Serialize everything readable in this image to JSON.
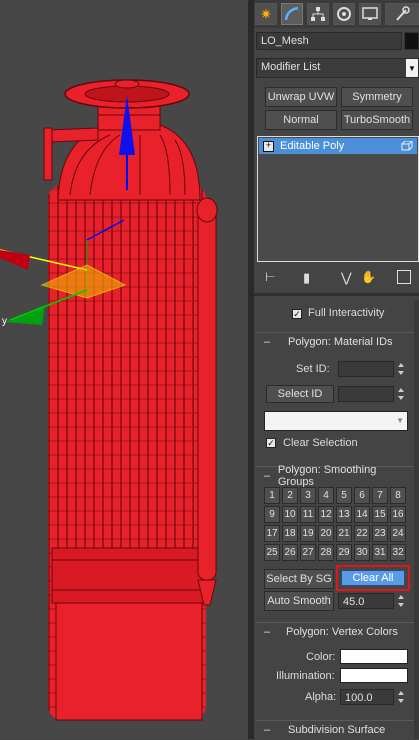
{
  "modifier_panel": {
    "object_name": "LO_Mesh",
    "modifier_list_label": "Modifier List",
    "buttons": {
      "unwrap": "Unwrap UVW",
      "symmetry": "Symmetry",
      "normal": "Normal",
      "turbosmooth": "TurboSmooth"
    },
    "stack": [
      {
        "label": "Editable Poly",
        "expand": "+"
      }
    ],
    "full_interactivity": "Full Interactivity"
  },
  "material_ids": {
    "title": "Polygon: Material IDs",
    "set_id_label": "Set ID:",
    "set_id_value": "",
    "select_id_button": "Select ID",
    "select_id_value": "",
    "dropdown_value": "",
    "clear_selection_label": "Clear Selection",
    "clear_selection_checked": true
  },
  "smoothing_groups": {
    "title": "Polygon: Smoothing Groups",
    "groups": [
      "1",
      "2",
      "3",
      "4",
      "5",
      "6",
      "7",
      "8",
      "9",
      "10",
      "11",
      "12",
      "13",
      "14",
      "15",
      "16",
      "17",
      "18",
      "19",
      "20",
      "21",
      "22",
      "23",
      "24",
      "25",
      "26",
      "27",
      "28",
      "29",
      "30",
      "31",
      "32"
    ],
    "select_by_sg": "Select By SG",
    "clear_all": "Clear All",
    "auto_smooth": "Auto Smooth",
    "auto_smooth_value": "45.0"
  },
  "vertex_colors": {
    "title": "Polygon: Vertex Colors",
    "color_label": "Color:",
    "illumination_label": "Illumination:",
    "alpha_label": "Alpha:",
    "alpha_value": "100.0",
    "color_value": "#ffffff",
    "illumination_value": "#ffffff"
  },
  "subdivision": {
    "title": "Subdivision Surface"
  },
  "colors": {
    "mesh": "#e8212b",
    "highlight_box": "#e0161c",
    "selected_row": "#4a8fd8",
    "viewport_bg": "#474747"
  },
  "icons": [
    "create-icon",
    "modify-icon",
    "hierarchy-icon",
    "motion-icon",
    "display-icon",
    "utilities-icon"
  ]
}
